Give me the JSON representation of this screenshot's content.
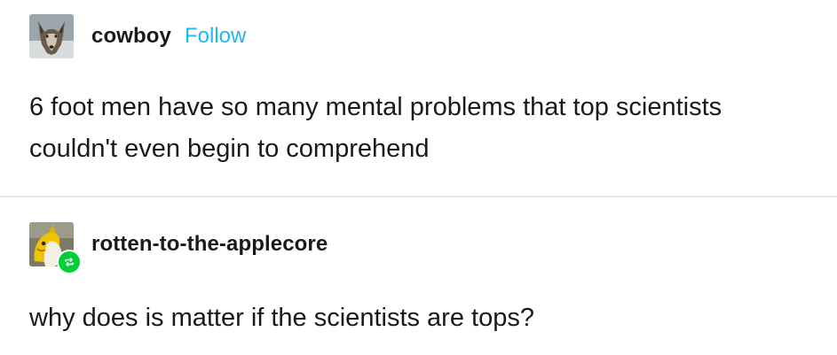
{
  "original_post": {
    "username": "cowboy",
    "follow_label": "Follow",
    "avatar_icon": "wolf-avatar-icon",
    "text_lines": [
      "6 foot men have so many mental problems that top scientists",
      "couldn't even begin to comprehend"
    ]
  },
  "reblog_post": {
    "username": "rotten-to-the-applecore",
    "avatar_icon": "yellow-character-avatar-icon",
    "badge_icon": "reblog-icon",
    "text": "why does is matter if the scientists are tops?"
  },
  "colors": {
    "follow": "#1eb7f0",
    "reblog_badge": "#00cf35",
    "text": "#1a1a1a",
    "divider": "#e6e6e6"
  }
}
